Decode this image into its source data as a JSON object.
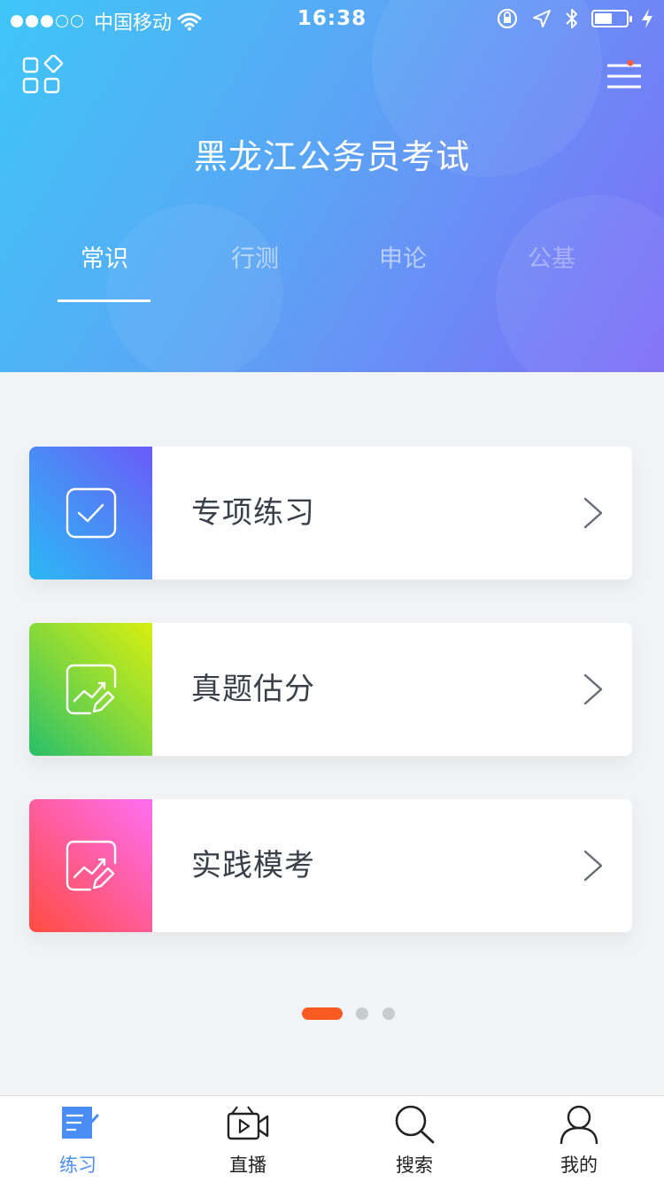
{
  "status_bar": {
    "carrier": "中国移动",
    "time": "16:38"
  },
  "header": {
    "title": "黑龙江公务员考试",
    "tabs": [
      {
        "label": "常识",
        "active": true
      },
      {
        "label": "行测",
        "active": false
      },
      {
        "label": "申论",
        "active": false
      },
      {
        "label": "公基",
        "active": false
      }
    ]
  },
  "cards": [
    {
      "label": "专项练习",
      "icon": "checkbox-icon",
      "gradient": [
        "#2bb8f5",
        "#6a5af7"
      ]
    },
    {
      "label": "真题估分",
      "icon": "chart-edit-icon",
      "gradient": [
        "#3cc37a",
        "#d4ef12"
      ]
    },
    {
      "label": "实践模考",
      "icon": "chart-edit-icon",
      "gradient": [
        "#ff4c46",
        "#ff6cf0"
      ]
    }
  ],
  "pager": {
    "pages": 3,
    "current": 1,
    "active_color": "#fb5a22"
  },
  "bottom_nav": [
    {
      "label": "练习",
      "icon": "practice-icon",
      "active": true
    },
    {
      "label": "直播",
      "icon": "video-icon",
      "active": false
    },
    {
      "label": "搜索",
      "icon": "search-icon",
      "active": false
    },
    {
      "label": "我的",
      "icon": "user-icon",
      "active": false
    }
  ],
  "colors": {
    "accent": "#4a8df5",
    "notification_dot": "#ff5a3c"
  }
}
